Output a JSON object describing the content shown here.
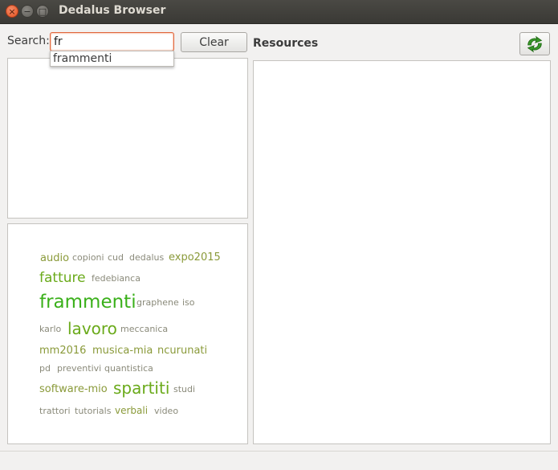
{
  "window": {
    "title": "Dedalus Browser",
    "close_glyph": "×",
    "min_glyph": "−",
    "max_glyph": "□"
  },
  "search": {
    "label": "Search:",
    "value": "fr",
    "suggestions": [
      "frammenti"
    ]
  },
  "clear_label": "Clear",
  "resources_label": "Resources",
  "refresh_icon": "refresh-arrows-icon",
  "colors": {
    "accent": "#e0643a",
    "refresh": "#3a9a2a",
    "tag_small": "#8a8a7a",
    "tag_mid": "#8a9a3a",
    "tag_large": "#6aaa1a",
    "tag_xlarge": "#3ab01a"
  },
  "tag_cloud": [
    {
      "label": "audio",
      "weight": 3
    },
    {
      "label": "copioni",
      "weight": 1
    },
    {
      "label": "cud",
      "weight": 1
    },
    {
      "label": "dedalus",
      "weight": 1
    },
    {
      "label": "expo2015",
      "weight": 3
    },
    {
      "label": "fatture",
      "weight": 5
    },
    {
      "label": "fedebianca",
      "weight": 1
    },
    {
      "label": "frammenti",
      "weight": 7
    },
    {
      "label": "graphene",
      "weight": 1
    },
    {
      "label": "iso",
      "weight": 1
    },
    {
      "label": "karlo",
      "weight": 1
    },
    {
      "label": "lavoro",
      "weight": 6
    },
    {
      "label": "meccanica",
      "weight": 1
    },
    {
      "label": "mm2016",
      "weight": 3
    },
    {
      "label": "musica-mia",
      "weight": 3
    },
    {
      "label": "ncurunati",
      "weight": 3
    },
    {
      "label": "pd",
      "weight": 1
    },
    {
      "label": "preventivi",
      "weight": 1
    },
    {
      "label": "quantistica",
      "weight": 1
    },
    {
      "label": "software-mio",
      "weight": 3
    },
    {
      "label": "spartiti",
      "weight": 6
    },
    {
      "label": "studi",
      "weight": 1
    },
    {
      "label": "trattori",
      "weight": 1
    },
    {
      "label": "tutorials",
      "weight": 1
    },
    {
      "label": "verbali",
      "weight": 2
    },
    {
      "label": "video",
      "weight": 1
    }
  ]
}
